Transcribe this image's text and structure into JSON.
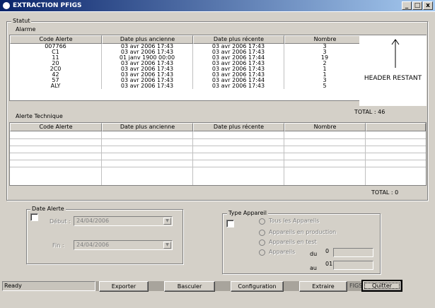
{
  "window": {
    "title": "EXTRACTION PFIGS",
    "controls": {
      "minimize": "_",
      "maximize": "□",
      "close": "x"
    }
  },
  "statut_group": {
    "label": "Statut"
  },
  "alarme": {
    "label": "Alarme",
    "columns": [
      "Code Alerte",
      "Date plus ancienne",
      "Date plus récente",
      "Nombre"
    ],
    "rows": [
      [
        "007766",
        "03 avr 2006 17:43",
        "03 avr 2006 17:43",
        "3"
      ],
      [
        "C1",
        "03 avr 2006 17:43",
        "03 avr 2006 17:43",
        "3"
      ],
      [
        "11",
        "01 janv 1900 00:00",
        "03 avr 2006 17:44",
        "19"
      ],
      [
        "20",
        "03 avr 2006 17:43",
        "03 avr 2006 17:43",
        "2"
      ],
      [
        "2C0",
        "03 avr 2006 17:43",
        "03 avr 2006 17:43",
        "1"
      ],
      [
        "42",
        "03 avr 2006 17:43",
        "03 avr 2006 17:43",
        "1"
      ],
      [
        "57",
        "03 avr 2006 17:43",
        "03 avr 2006 17:44",
        "3"
      ],
      [
        "ALY",
        "03 avr 2006 17:43",
        "03 avr 2006 17:43",
        "5"
      ]
    ],
    "total": "TOTAL : 46"
  },
  "annotation": {
    "header_restant": "HEADER RESTANT"
  },
  "alerte_technique": {
    "label": "Alerte Technique",
    "columns": [
      "Code Alerte",
      "Date plus ancienne",
      "Date plus récente",
      "Nombre"
    ],
    "rows": [],
    "total": "TOTAL : 0"
  },
  "date_alerte": {
    "label": "Date Alerte",
    "debut_label": "Début :",
    "debut_value": "24/04/2006",
    "fin_label": "Fin :",
    "fin_value": "24/04/2006"
  },
  "type_appareil": {
    "label": "Type Appareil",
    "options": [
      "Tous les Appareils",
      "Appareils en production",
      "Appareils en test",
      "Appareils"
    ],
    "du_label": "du",
    "du_value": "0",
    "au_label": "au",
    "au_value": "01"
  },
  "status": {
    "text": "Ready",
    "fragment": "FIGS"
  },
  "buttons": {
    "exporter": "Exporter",
    "basculer": "Basculer",
    "configuration": "Configuration",
    "extraire": "Extraire",
    "quitter": "Quitter"
  }
}
